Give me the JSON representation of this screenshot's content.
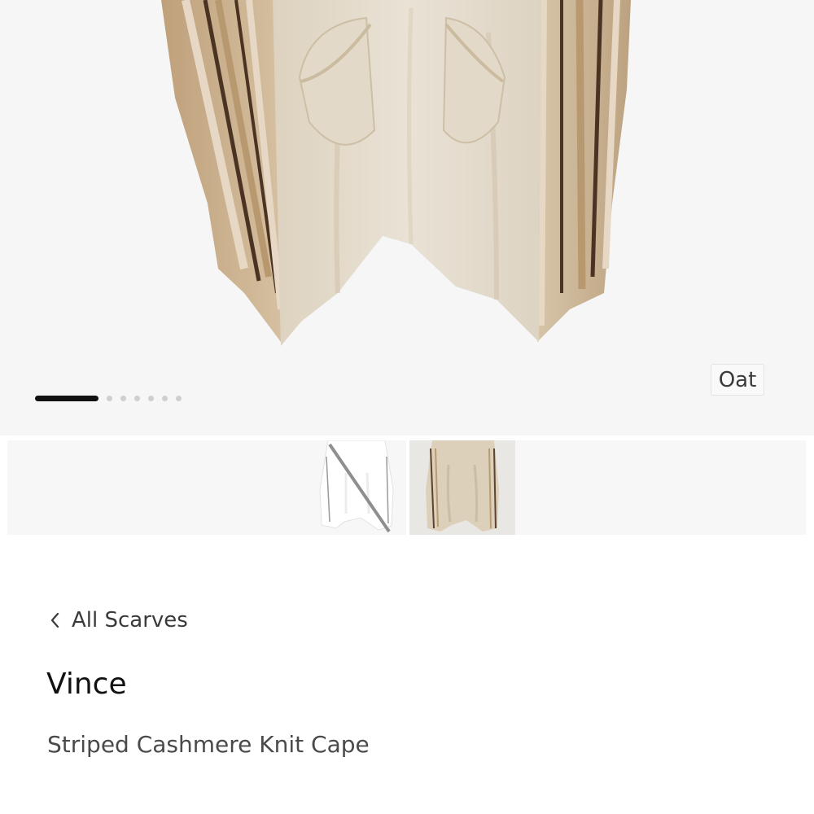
{
  "gallery": {
    "page_count": 8,
    "current_page": 1,
    "color_label": "Oat"
  },
  "swatches": [
    {
      "name": "ivory",
      "available": false,
      "color": "#f3f3f1"
    },
    {
      "name": "oat",
      "available": true,
      "selected": true,
      "color": "#ddd2bd"
    }
  ],
  "breadcrumb": {
    "label": "All Scarves",
    "icon": "chevron-left-icon"
  },
  "product": {
    "brand": "Vince",
    "name": "Striped Cashmere Knit Cape"
  },
  "colors": {
    "hero_background": "#f6f6f6",
    "garment_main": "#e6ddcd",
    "garment_side": "#c9ae8a",
    "stripe_dark": "#4a3322",
    "pager_active": "#111111",
    "pager_inactive": "#cfcfcf"
  }
}
